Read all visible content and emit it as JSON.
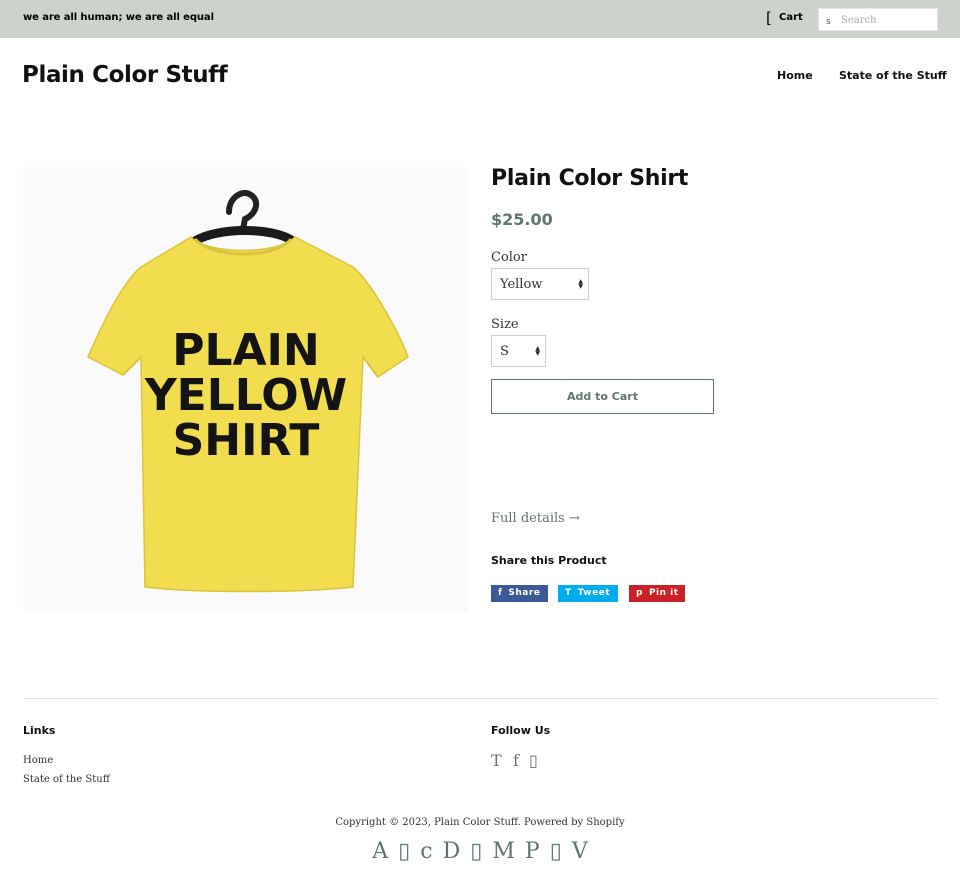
{
  "topbar": {
    "announcement": "we are all human; we are all equal",
    "cart_icon": "[",
    "cart_label": "Cart",
    "search_icon_glyph": "s",
    "search_placeholder": "Search"
  },
  "header": {
    "logo": "Plain Color Stuff",
    "nav": [
      {
        "label": "Home"
      },
      {
        "label": "State of the Stuff"
      }
    ]
  },
  "product": {
    "image_text_lines": [
      "PLAIN",
      "YELLOW",
      "SHIRT"
    ],
    "title": "Plain Color Shirt",
    "price": "$25.00",
    "color_label": "Color",
    "color_value": "Yellow",
    "size_label": "Size",
    "size_value": "S",
    "add_to_cart": "Add to Cart",
    "full_details": "Full details →",
    "share_heading": "Share this Product",
    "share_buttons": [
      {
        "icon": "f",
        "label": "Share"
      },
      {
        "icon": "T",
        "label": "Tweet"
      },
      {
        "icon": "p",
        "label": "Pin it"
      }
    ]
  },
  "footer": {
    "links_heading": "Links",
    "links": [
      {
        "label": "Home"
      },
      {
        "label": "State of the Stuff"
      }
    ],
    "follow_heading": "Follow Us",
    "social_icons": [
      "T",
      "f",
      "▯"
    ],
    "copyright": "Copyright © 2023, Plain Color Stuff. Powered by Shopify",
    "payment_icons": [
      "A",
      "▯",
      "c",
      "D",
      "▯",
      "M",
      "P",
      "▯",
      "V"
    ]
  },
  "colors": {
    "topbar_bg": "#cbd3cc",
    "accent": "#5f7570",
    "shirt_yellow": "#f2dd4e",
    "facebook": "#3b5998",
    "twitter": "#00aced",
    "pinterest": "#cb2027"
  }
}
